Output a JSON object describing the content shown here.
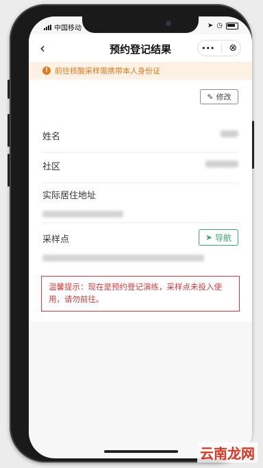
{
  "status_bar": {
    "carrier": "中国移动"
  },
  "navbar": {
    "back_glyph": "‹",
    "title": "预约登记结果",
    "more_glyph": "•••",
    "close_glyph": "⊗"
  },
  "notice": {
    "text": "前往核酸采样需携带本人身份证"
  },
  "record": {
    "edit_label": "修改",
    "fields": [
      {
        "label": "姓名"
      },
      {
        "label": "社区"
      },
      {
        "label": "实际居住地址"
      },
      {
        "label": "采样点"
      }
    ],
    "navigate_label": "导航"
  },
  "tip": {
    "text": "温馨提示：现在是预约登记演练，采样点未投入使用，请勿前往。"
  },
  "watermark": "云南龙网",
  "colors": {
    "accent_green": "#3aa76d",
    "warning_orange": "#e07a1f",
    "alert_red": "#d8393a"
  }
}
